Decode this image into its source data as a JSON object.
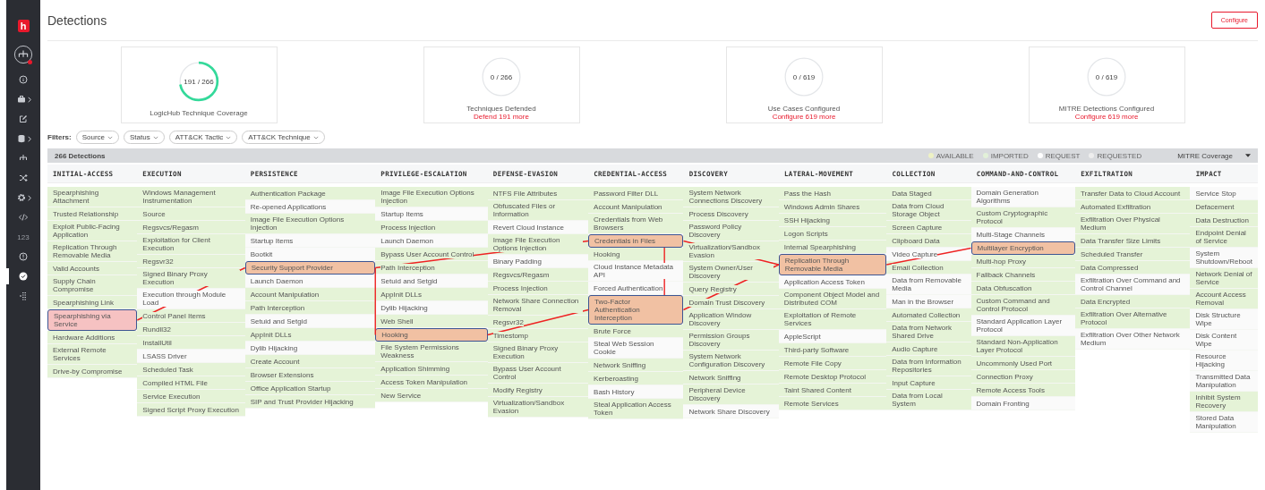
{
  "sidebar": {
    "logo": "h",
    "items": [
      {
        "kind": "org",
        "selected": false,
        "submenu": false,
        "alert": true
      },
      {
        "kind": "info",
        "selected": false,
        "submenu": false,
        "alert": false
      },
      {
        "kind": "briefcase",
        "selected": false,
        "submenu": true,
        "alert": false
      },
      {
        "kind": "edit",
        "selected": false,
        "submenu": false,
        "alert": false
      },
      {
        "kind": "database",
        "selected": false,
        "submenu": true,
        "alert": false
      },
      {
        "kind": "hierarchy",
        "selected": false,
        "submenu": false,
        "alert": false
      },
      {
        "kind": "shuffle",
        "selected": false,
        "submenu": false,
        "alert": false
      },
      {
        "kind": "gear",
        "selected": false,
        "submenu": true,
        "alert": false
      },
      {
        "kind": "code",
        "selected": false,
        "submenu": false,
        "alert": false
      },
      {
        "kind": "text",
        "label": "123",
        "selected": false,
        "submenu": false,
        "alert": false
      },
      {
        "kind": "alert",
        "selected": false,
        "submenu": false,
        "alert": false
      },
      {
        "kind": "check",
        "selected": true,
        "submenu": false,
        "alert": false
      },
      {
        "kind": "grid",
        "selected": false,
        "submenu": false,
        "alert": false
      }
    ]
  },
  "page": {
    "title": "Detections",
    "button": "Configure"
  },
  "cards": [
    {
      "value": "191 / 266",
      "label": "LogicHub Technique Coverage"
    },
    {
      "value": "0 / 266",
      "label": "Techniques Defended",
      "link": "Defend 191 more"
    },
    {
      "value": "0 / 619",
      "label": "Use Cases Configured",
      "link": "Configure 619 more"
    },
    {
      "value": "0 / 619",
      "label": "MITRE Detections Configured",
      "link": "Configure 619 more"
    }
  ],
  "filters": {
    "label": "Filters:",
    "chips": [
      "Source",
      "Status",
      "ATT&CK Tactic",
      "ATT&CK Technique"
    ]
  },
  "summary": {
    "count": "266 Detections",
    "legend": [
      {
        "label": "AVAILABLE",
        "color": "#eef2c4"
      },
      {
        "label": "IMPORTED",
        "color": "#e2f0d8"
      },
      {
        "label": "REQUEST",
        "color": "#ffffff"
      },
      {
        "label": "REQUESTED",
        "color": "#eeeeee"
      }
    ],
    "view": "MITRE Coverage"
  },
  "matrix": [
    {
      "tactic": "INITIAL-ACCESS",
      "cells": [
        {
          "name": "Spearphishing Attachment",
          "available": true
        },
        {
          "name": "Trusted Relationship",
          "available": true
        },
        {
          "name": "Exploit Public-Facing Application",
          "available": true
        },
        {
          "name": "Replication Through Removable Media",
          "available": true
        },
        {
          "name": "Valid Accounts",
          "available": true
        },
        {
          "name": "Supply Chain Compromise",
          "available": true
        },
        {
          "name": "Spearphishing Link",
          "available": true
        },
        {
          "name": "Spearphishing via Service",
          "color": "#f6c2c2"
        },
        {
          "name": "Hardware Additions",
          "available": true
        },
        {
          "name": "External Remote Services",
          "available": true
        },
        {
          "name": "Drive-by Compromise",
          "available": true
        }
      ]
    },
    {
      "tactic": "EXECUTION",
      "cells": [
        {
          "name": "Windows Management Instrumentation",
          "available": true
        },
        {
          "name": "Source",
          "available": true
        },
        {
          "name": "Regsvcs/Regasm",
          "available": true
        },
        {
          "name": "Exploitation for Client Execution",
          "available": true
        },
        {
          "name": "Regsvr32",
          "available": true
        },
        {
          "name": "Signed Binary Proxy Execution",
          "available": true
        },
        {
          "name": "Execution through Module Load",
          "available": false
        },
        {
          "name": "Control Panel Items",
          "available": true
        },
        {
          "name": "Rundll32",
          "available": true
        },
        {
          "name": "InstallUtil",
          "available": true
        },
        {
          "name": "LSASS Driver",
          "available": false
        },
        {
          "name": "Scheduled Task",
          "available": true
        },
        {
          "name": "Compiled HTML File",
          "available": true
        },
        {
          "name": "Service Execution",
          "available": true
        },
        {
          "name": "Signed Script Proxy Execution",
          "available": true
        }
      ]
    },
    {
      "tactic": "PERSISTENCE",
      "cells": [
        {
          "name": "Authentication Package",
          "available": true
        },
        {
          "name": "Re-opened Applications",
          "available": false
        },
        {
          "name": "Image File Execution Options Injection",
          "available": true
        },
        {
          "name": "Startup Items",
          "available": false
        },
        {
          "name": "Bootkit",
          "available": false
        },
        {
          "name": "Security Support Provider",
          "color": "#f1c1a3"
        },
        {
          "name": "Launch Daemon",
          "available": false
        },
        {
          "name": "Account Manipulation",
          "available": true
        },
        {
          "name": "Path Interception",
          "available": true
        },
        {
          "name": "Setuid and Setgid",
          "available": false
        },
        {
          "name": "AppInit DLLs",
          "available": true
        },
        {
          "name": "Dylib Hijacking",
          "available": false
        },
        {
          "name": "Create Account",
          "available": true
        },
        {
          "name": "Browser Extensions",
          "available": true
        },
        {
          "name": "Office Application Startup",
          "available": true
        },
        {
          "name": "SIP and Trust Provider Hijacking",
          "available": true
        }
      ]
    },
    {
      "tactic": "PRIVILEGE-ESCALATION",
      "cells": [
        {
          "name": "Image File Execution Options Injection",
          "available": true
        },
        {
          "name": "Startup Items",
          "available": false
        },
        {
          "name": "Process Injection",
          "available": true
        },
        {
          "name": "Launch Daemon",
          "available": false
        },
        {
          "name": "Bypass User Account Control",
          "available": true
        },
        {
          "name": "Path Interception",
          "available": true
        },
        {
          "name": "Setuid and Setgid",
          "available": false
        },
        {
          "name": "AppInit DLLs",
          "available": true
        },
        {
          "name": "Dylib Hijacking",
          "available": false
        },
        {
          "name": "Web Shell",
          "available": true
        },
        {
          "name": "Hooking",
          "color": "#f1c1a3"
        },
        {
          "name": "File System Permissions Weakness",
          "available": true
        },
        {
          "name": "Application Shimming",
          "available": true
        },
        {
          "name": "Access Token Manipulation",
          "available": true
        },
        {
          "name": "New Service",
          "available": true
        }
      ]
    },
    {
      "tactic": "DEFENSE-EVASION",
      "cells": [
        {
          "name": "NTFS File Attributes",
          "available": true
        },
        {
          "name": "Obfuscated Files or Information",
          "available": true
        },
        {
          "name": "Revert Cloud Instance",
          "available": false
        },
        {
          "name": "Image File Execution Options Injection",
          "available": true
        },
        {
          "name": "Binary Padding",
          "available": false
        },
        {
          "name": "Regsvcs/Regasm",
          "available": true
        },
        {
          "name": "Process Injection",
          "available": true
        },
        {
          "name": "Network Share Connection Removal",
          "available": true
        },
        {
          "name": "Regsvr32",
          "available": true
        },
        {
          "name": "Timestomp",
          "available": true
        },
        {
          "name": "Signed Binary Proxy Execution",
          "available": true
        },
        {
          "name": "Bypass User Account Control",
          "available": true
        },
        {
          "name": "Modify Registry",
          "available": true
        },
        {
          "name": "Virtualization/Sandbox Evasion",
          "available": true
        }
      ]
    },
    {
      "tactic": "CREDENTIAL-ACCESS",
      "cells": [
        {
          "name": "Password Filter DLL",
          "available": true
        },
        {
          "name": "Account Manipulation",
          "available": true
        },
        {
          "name": "Credentials from Web Browsers",
          "available": true
        },
        {
          "name": "Credentials in Files",
          "color": "#f1c1a3"
        },
        {
          "name": "Hooking",
          "available": true
        },
        {
          "name": "Cloud Instance Metadata API",
          "available": false
        },
        {
          "name": "Forced Authentication",
          "available": false
        },
        {
          "name": "Two-Factor Authentication Interception",
          "color": "#f1c1a3"
        },
        {
          "name": "Brute Force",
          "available": true
        },
        {
          "name": "Steal Web Session Cookie",
          "available": false
        },
        {
          "name": "Network Sniffing",
          "available": true
        },
        {
          "name": "Kerberoasting",
          "available": true
        },
        {
          "name": "Bash History",
          "available": false
        },
        {
          "name": "Steal Application Access Token",
          "available": true
        }
      ]
    },
    {
      "tactic": "DISCOVERY",
      "cells": [
        {
          "name": "System Network Connections Discovery",
          "available": true
        },
        {
          "name": "Process Discovery",
          "available": true
        },
        {
          "name": "Password Policy Discovery",
          "available": true
        },
        {
          "name": "Virtualization/Sandbox Evasion",
          "available": true
        },
        {
          "name": "System Owner/User Discovery",
          "available": true
        },
        {
          "name": "Query Registry",
          "available": true
        },
        {
          "name": "Domain Trust Discovery",
          "available": true
        },
        {
          "name": "Application Window Discovery",
          "available": true
        },
        {
          "name": "Permission Groups Discovery",
          "available": true
        },
        {
          "name": "System Network Configuration Discovery",
          "available": true
        },
        {
          "name": "Network Sniffing",
          "available": true
        },
        {
          "name": "Peripheral Device Discovery",
          "available": true
        },
        {
          "name": "Network Share Discovery",
          "available": false
        }
      ]
    },
    {
      "tactic": "LATERAL-MOVEMENT",
      "cells": [
        {
          "name": "Pass the Hash",
          "available": true
        },
        {
          "name": "Windows Admin Shares",
          "available": true
        },
        {
          "name": "SSH Hijacking",
          "available": true
        },
        {
          "name": "Logon Scripts",
          "available": true
        },
        {
          "name": "Internal Spearphishing",
          "available": true
        },
        {
          "name": "Replication Through Removable Media",
          "color": "#f1c1a3"
        },
        {
          "name": "Application Access Token",
          "available": false
        },
        {
          "name": "Component Object Model and Distributed COM",
          "available": true
        },
        {
          "name": "Exploitation of Remote Services",
          "available": true
        },
        {
          "name": "AppleScript",
          "available": false
        },
        {
          "name": "Third-party Software",
          "available": true
        },
        {
          "name": "Remote File Copy",
          "available": true
        },
        {
          "name": "Remote Desktop Protocol",
          "available": true
        },
        {
          "name": "Taint Shared Content",
          "available": true
        },
        {
          "name": "Remote Services",
          "available": true
        }
      ]
    },
    {
      "tactic": "COLLECTION",
      "cells": [
        {
          "name": "Data Staged",
          "available": true
        },
        {
          "name": "Data from Cloud Storage Object",
          "available": true
        },
        {
          "name": "Screen Capture",
          "available": true
        },
        {
          "name": "Clipboard Data",
          "available": true
        },
        {
          "name": "Video Capture",
          "available": false
        },
        {
          "name": "Email Collection",
          "available": true
        },
        {
          "name": "Data from Removable Media",
          "available": false
        },
        {
          "name": "Man in the Browser",
          "available": false
        },
        {
          "name": "Automated Collection",
          "available": true
        },
        {
          "name": "Data from Network Shared Drive",
          "available": true
        },
        {
          "name": "Audio Capture",
          "available": true
        },
        {
          "name": "Data from Information Repositories",
          "available": true
        },
        {
          "name": "Input Capture",
          "available": true
        },
        {
          "name": "Data from Local System",
          "available": true
        }
      ]
    },
    {
      "tactic": "COMMAND-AND-CONTROL",
      "cells": [
        {
          "name": "Domain Generation Algorithms",
          "available": false
        },
        {
          "name": "Custom Cryptographic Protocol",
          "available": true
        },
        {
          "name": "Multi-Stage Channels",
          "available": false
        },
        {
          "name": "Multilayer Encryption",
          "color": "#f1c1a3"
        },
        {
          "name": "Multi-hop Proxy",
          "available": true
        },
        {
          "name": "Fallback Channels",
          "available": true
        },
        {
          "name": "Data Obfuscation",
          "available": true
        },
        {
          "name": "Custom Command and Control Protocol",
          "available": true
        },
        {
          "name": "Standard Application Layer Protocol",
          "available": false
        },
        {
          "name": "Standard Non-Application Layer Protocol",
          "available": true
        },
        {
          "name": "Uncommonly Used Port",
          "available": true
        },
        {
          "name": "Connection Proxy",
          "available": true
        },
        {
          "name": "Remote Access Tools",
          "available": true
        },
        {
          "name": "Domain Fronting",
          "available": false
        }
      ]
    },
    {
      "tactic": "EXFILTRATION",
      "cells": [
        {
          "name": "Transfer Data to Cloud Account",
          "available": true
        },
        {
          "name": "Automated Exfiltration",
          "available": true
        },
        {
          "name": "Exfiltration Over Physical Medium",
          "available": true
        },
        {
          "name": "Data Transfer Size Limits",
          "available": true
        },
        {
          "name": "Scheduled Transfer",
          "available": true
        },
        {
          "name": "Data Compressed",
          "available": true
        },
        {
          "name": "Exfiltration Over Command and Control Channel",
          "available": false
        },
        {
          "name": "Data Encrypted",
          "available": true
        },
        {
          "name": "Exfiltration Over Alternative Protocol",
          "available": true
        },
        {
          "name": "Exfiltration Over Other Network Medium",
          "available": false
        }
      ]
    },
    {
      "tactic": "IMPACT",
      "cells": [
        {
          "name": "Service Stop",
          "available": false
        },
        {
          "name": "Defacement",
          "available": true
        },
        {
          "name": "Data Destruction",
          "available": true
        },
        {
          "name": "Endpoint Denial of Service",
          "available": true
        },
        {
          "name": "System Shutdown/Reboot",
          "available": false
        },
        {
          "name": "Network Denial of Service",
          "available": true
        },
        {
          "name": "Account Access Removal",
          "available": true
        },
        {
          "name": "Disk Structure Wipe",
          "available": false
        },
        {
          "name": "Disk Content Wipe",
          "available": false
        },
        {
          "name": "Resource Hijacking",
          "available": false
        },
        {
          "name": "Transmitted Data Manipulation",
          "available": false
        },
        {
          "name": "Inhibit System Recovery",
          "available": true
        },
        {
          "name": "Stored Data Manipulation",
          "available": false
        }
      ]
    }
  ]
}
